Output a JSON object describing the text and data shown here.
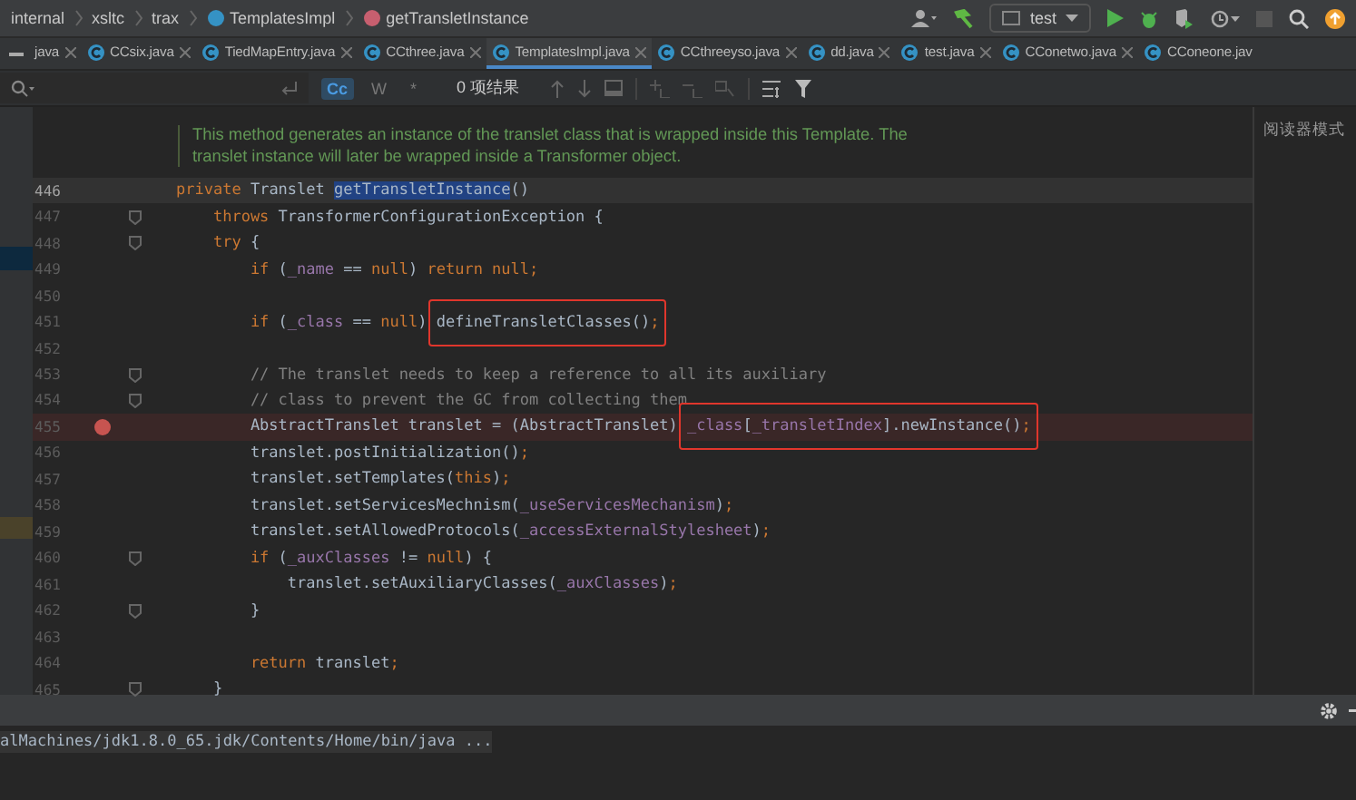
{
  "breadcrumbs": [
    {
      "label": "internal",
      "kind": "package"
    },
    {
      "label": "xsltc",
      "kind": "package"
    },
    {
      "label": "trax",
      "kind": "package"
    },
    {
      "label": "TemplatesImpl",
      "kind": "class"
    },
    {
      "label": "getTransletInstance",
      "kind": "method"
    }
  ],
  "run_config": {
    "label": "test"
  },
  "tabs": [
    {
      "label": "java",
      "selected": false,
      "icon": false
    },
    {
      "label": "CCsix.java",
      "selected": false,
      "icon": true
    },
    {
      "label": "TiedMapEntry.java",
      "selected": false,
      "icon": true
    },
    {
      "label": "CCthree.java",
      "selected": false,
      "icon": true
    },
    {
      "label": "TemplatesImpl.java",
      "selected": true,
      "icon": true
    },
    {
      "label": "CCthreeyso.java",
      "selected": false,
      "icon": true
    },
    {
      "label": "dd.java",
      "selected": false,
      "icon": true
    },
    {
      "label": "test.java",
      "selected": false,
      "icon": true
    },
    {
      "label": "CConetwo.java",
      "selected": false,
      "icon": true
    },
    {
      "label": "CConeone.jav",
      "selected": false,
      "icon": true
    }
  ],
  "find_bar": {
    "match_case": {
      "label": "Cc",
      "selected": true
    },
    "words": {
      "label": "W",
      "selected": false
    },
    "regex": {
      "label": "*",
      "selected": false
    },
    "result": "0 项结果"
  },
  "reader_mode": "阅读器模式",
  "javadoc": [
    "This method generates an instance of the translet class that is wrapped inside this Template. The",
    "translet instance will later be wrapped inside a Transformer object."
  ],
  "lines": [
    {
      "number": "446",
      "current": true,
      "breakpoint": false,
      "fold_marker": false,
      "code": [
        {
          "kind": "kw",
          "text": "private "
        },
        {
          "kind": "plain",
          "text": "Translet "
        },
        {
          "kind": "match",
          "text": "getTransletInstance"
        },
        {
          "kind": "plain",
          "text": "()"
        }
      ]
    },
    {
      "number": "447",
      "current": false,
      "breakpoint": false,
      "fold_marker": true,
      "code": [
        {
          "kind": "kw",
          "text": "    throws "
        },
        {
          "kind": "plain",
          "text": "TransformerConfigurationException {"
        }
      ]
    },
    {
      "number": "448",
      "current": false,
      "breakpoint": false,
      "fold_marker": true,
      "code": [
        {
          "kind": "kw",
          "text": "    try "
        },
        {
          "kind": "plain",
          "text": "{"
        }
      ]
    },
    {
      "number": "449",
      "current": false,
      "breakpoint": false,
      "fold_marker": false,
      "code": [
        {
          "kind": "kw",
          "text": "        if "
        },
        {
          "kind": "plain",
          "text": "("
        },
        {
          "kind": "field",
          "text": "_name"
        },
        {
          "kind": "plain",
          "text": " == "
        },
        {
          "kind": "kw",
          "text": "null"
        },
        {
          "kind": "plain",
          "text": ") "
        },
        {
          "kind": "kw",
          "text": "return null;"
        }
      ]
    },
    {
      "number": "450",
      "current": false,
      "breakpoint": false,
      "fold_marker": false
    },
    {
      "number": "451",
      "current": false,
      "breakpoint": false,
      "fold_marker": false,
      "code": [
        {
          "kind": "kw",
          "text": "        if "
        },
        {
          "kind": "plain",
          "text": "("
        },
        {
          "kind": "field",
          "text": "_class"
        },
        {
          "kind": "plain",
          "text": " == "
        },
        {
          "kind": "kw",
          "text": "null"
        },
        {
          "kind": "plain",
          "text": ") "
        },
        {
          "kind": "box",
          "tokens": [
            {
              "kind": "plain",
              "text": "defineTransletClasses()"
            },
            {
              "kind": "kw",
              "text": ";"
            }
          ]
        }
      ]
    },
    {
      "number": "452",
      "current": false,
      "breakpoint": false,
      "fold_marker": false
    },
    {
      "number": "453",
      "current": false,
      "breakpoint": false,
      "fold_marker": true,
      "code": [
        {
          "kind": "comment",
          "text": "        // The translet needs to keep a reference to all its auxiliary"
        }
      ]
    },
    {
      "number": "454",
      "current": false,
      "breakpoint": false,
      "fold_marker": true,
      "code": [
        {
          "kind": "comment",
          "text": "        // class to prevent the GC from collecting them"
        }
      ]
    },
    {
      "number": "455",
      "current": false,
      "breakpoint": true,
      "fold_marker": false,
      "code": [
        {
          "kind": "plain",
          "text": "        AbstractTranslet translet = (AbstractTranslet) "
        },
        {
          "kind": "box",
          "tokens": [
            {
              "kind": "field",
              "text": "_class"
            },
            {
              "kind": "plain",
              "text": "["
            },
            {
              "kind": "field",
              "text": "_transletIndex"
            },
            {
              "kind": "plain",
              "text": "].newInstance()"
            },
            {
              "kind": "kw",
              "text": ";"
            }
          ]
        }
      ]
    },
    {
      "number": "456",
      "current": false,
      "breakpoint": false,
      "fold_marker": false,
      "code": [
        {
          "kind": "plain",
          "text": "        translet.postInitialization()"
        },
        {
          "kind": "kw",
          "text": ";"
        }
      ]
    },
    {
      "number": "457",
      "current": false,
      "breakpoint": false,
      "fold_marker": false,
      "code": [
        {
          "kind": "plain",
          "text": "        translet.setTemplates("
        },
        {
          "kind": "kw",
          "text": "this"
        },
        {
          "kind": "plain",
          "text": ")"
        },
        {
          "kind": "kw",
          "text": ";"
        }
      ]
    },
    {
      "number": "458",
      "current": false,
      "breakpoint": false,
      "fold_marker": false,
      "code": [
        {
          "kind": "plain",
          "text": "        translet.setServicesMechnism("
        },
        {
          "kind": "field",
          "text": "_useServicesMechanism"
        },
        {
          "kind": "plain",
          "text": ")"
        },
        {
          "kind": "kw",
          "text": ";"
        }
      ]
    },
    {
      "number": "459",
      "current": false,
      "breakpoint": false,
      "fold_marker": false,
      "code": [
        {
          "kind": "plain",
          "text": "        translet.setAllowedProtocols("
        },
        {
          "kind": "field",
          "text": "_accessExternalStylesheet"
        },
        {
          "kind": "plain",
          "text": ")"
        },
        {
          "kind": "kw",
          "text": ";"
        }
      ]
    },
    {
      "number": "460",
      "current": false,
      "breakpoint": false,
      "fold_marker": true,
      "code": [
        {
          "kind": "kw",
          "text": "        if "
        },
        {
          "kind": "plain",
          "text": "("
        },
        {
          "kind": "field",
          "text": "_auxClasses"
        },
        {
          "kind": "plain",
          "text": " != "
        },
        {
          "kind": "kw",
          "text": "null"
        },
        {
          "kind": "plain",
          "text": ") {"
        }
      ]
    },
    {
      "number": "461",
      "current": false,
      "breakpoint": false,
      "fold_marker": false,
      "code": [
        {
          "kind": "plain",
          "text": "            translet.setAuxiliaryClasses("
        },
        {
          "kind": "field",
          "text": "_auxClasses"
        },
        {
          "kind": "plain",
          "text": ")"
        },
        {
          "kind": "kw",
          "text": ";"
        }
      ]
    },
    {
      "number": "462",
      "current": false,
      "breakpoint": false,
      "fold_marker": true,
      "code": [
        {
          "kind": "plain",
          "text": "        }"
        }
      ]
    },
    {
      "number": "463",
      "current": false,
      "breakpoint": false,
      "fold_marker": false
    },
    {
      "number": "464",
      "current": false,
      "breakpoint": false,
      "fold_marker": false,
      "code": [
        {
          "kind": "kw",
          "text": "        return "
        },
        {
          "kind": "plain",
          "text": "translet"
        },
        {
          "kind": "kw",
          "text": ";"
        }
      ]
    },
    {
      "number": "465",
      "current": false,
      "breakpoint": false,
      "fold_marker": true,
      "code": [
        {
          "kind": "plain",
          "text": "    }"
        }
      ]
    }
  ],
  "console": {
    "output": "alMachines/jdk1.8.0_65.jdk/Contents/Home/bin/java ..."
  }
}
